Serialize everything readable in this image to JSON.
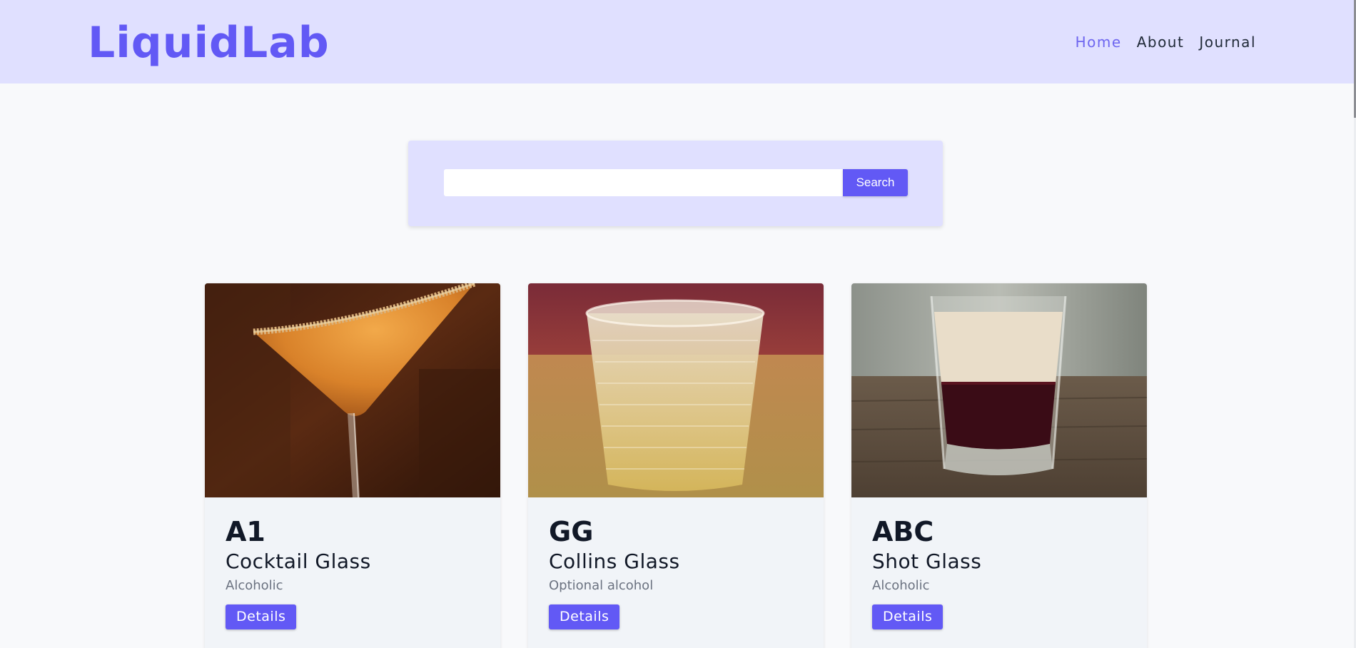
{
  "header": {
    "brand": "LiquidLab",
    "nav": [
      {
        "label": "Home",
        "active": true
      },
      {
        "label": "About",
        "active": false
      },
      {
        "label": "Journal",
        "active": false
      }
    ]
  },
  "search": {
    "placeholder": "",
    "value": "",
    "button_label": "Search"
  },
  "drinks": [
    {
      "code": "A1",
      "glass": "Cocktail Glass",
      "type": "Alcoholic",
      "button_label": "Details",
      "image": "orange cocktail in sugar-rimmed martini glass"
    },
    {
      "code": "GG",
      "glass": "Collins Glass",
      "type": "Optional alcohol",
      "button_label": "Details",
      "image": "pale drink with ice in textured tumbler"
    },
    {
      "code": "ABC",
      "glass": "Shot Glass",
      "type": "Alcoholic",
      "button_label": "Details",
      "image": "layered cream and dark red shot"
    }
  ],
  "colors": {
    "accent": "#6259f5",
    "header_bg": "#e0e0ff",
    "nav_active": "#6e66f0",
    "page_bg": "#f8f9fb",
    "card_bg": "#f1f4f8",
    "muted_text": "#6b7280"
  }
}
